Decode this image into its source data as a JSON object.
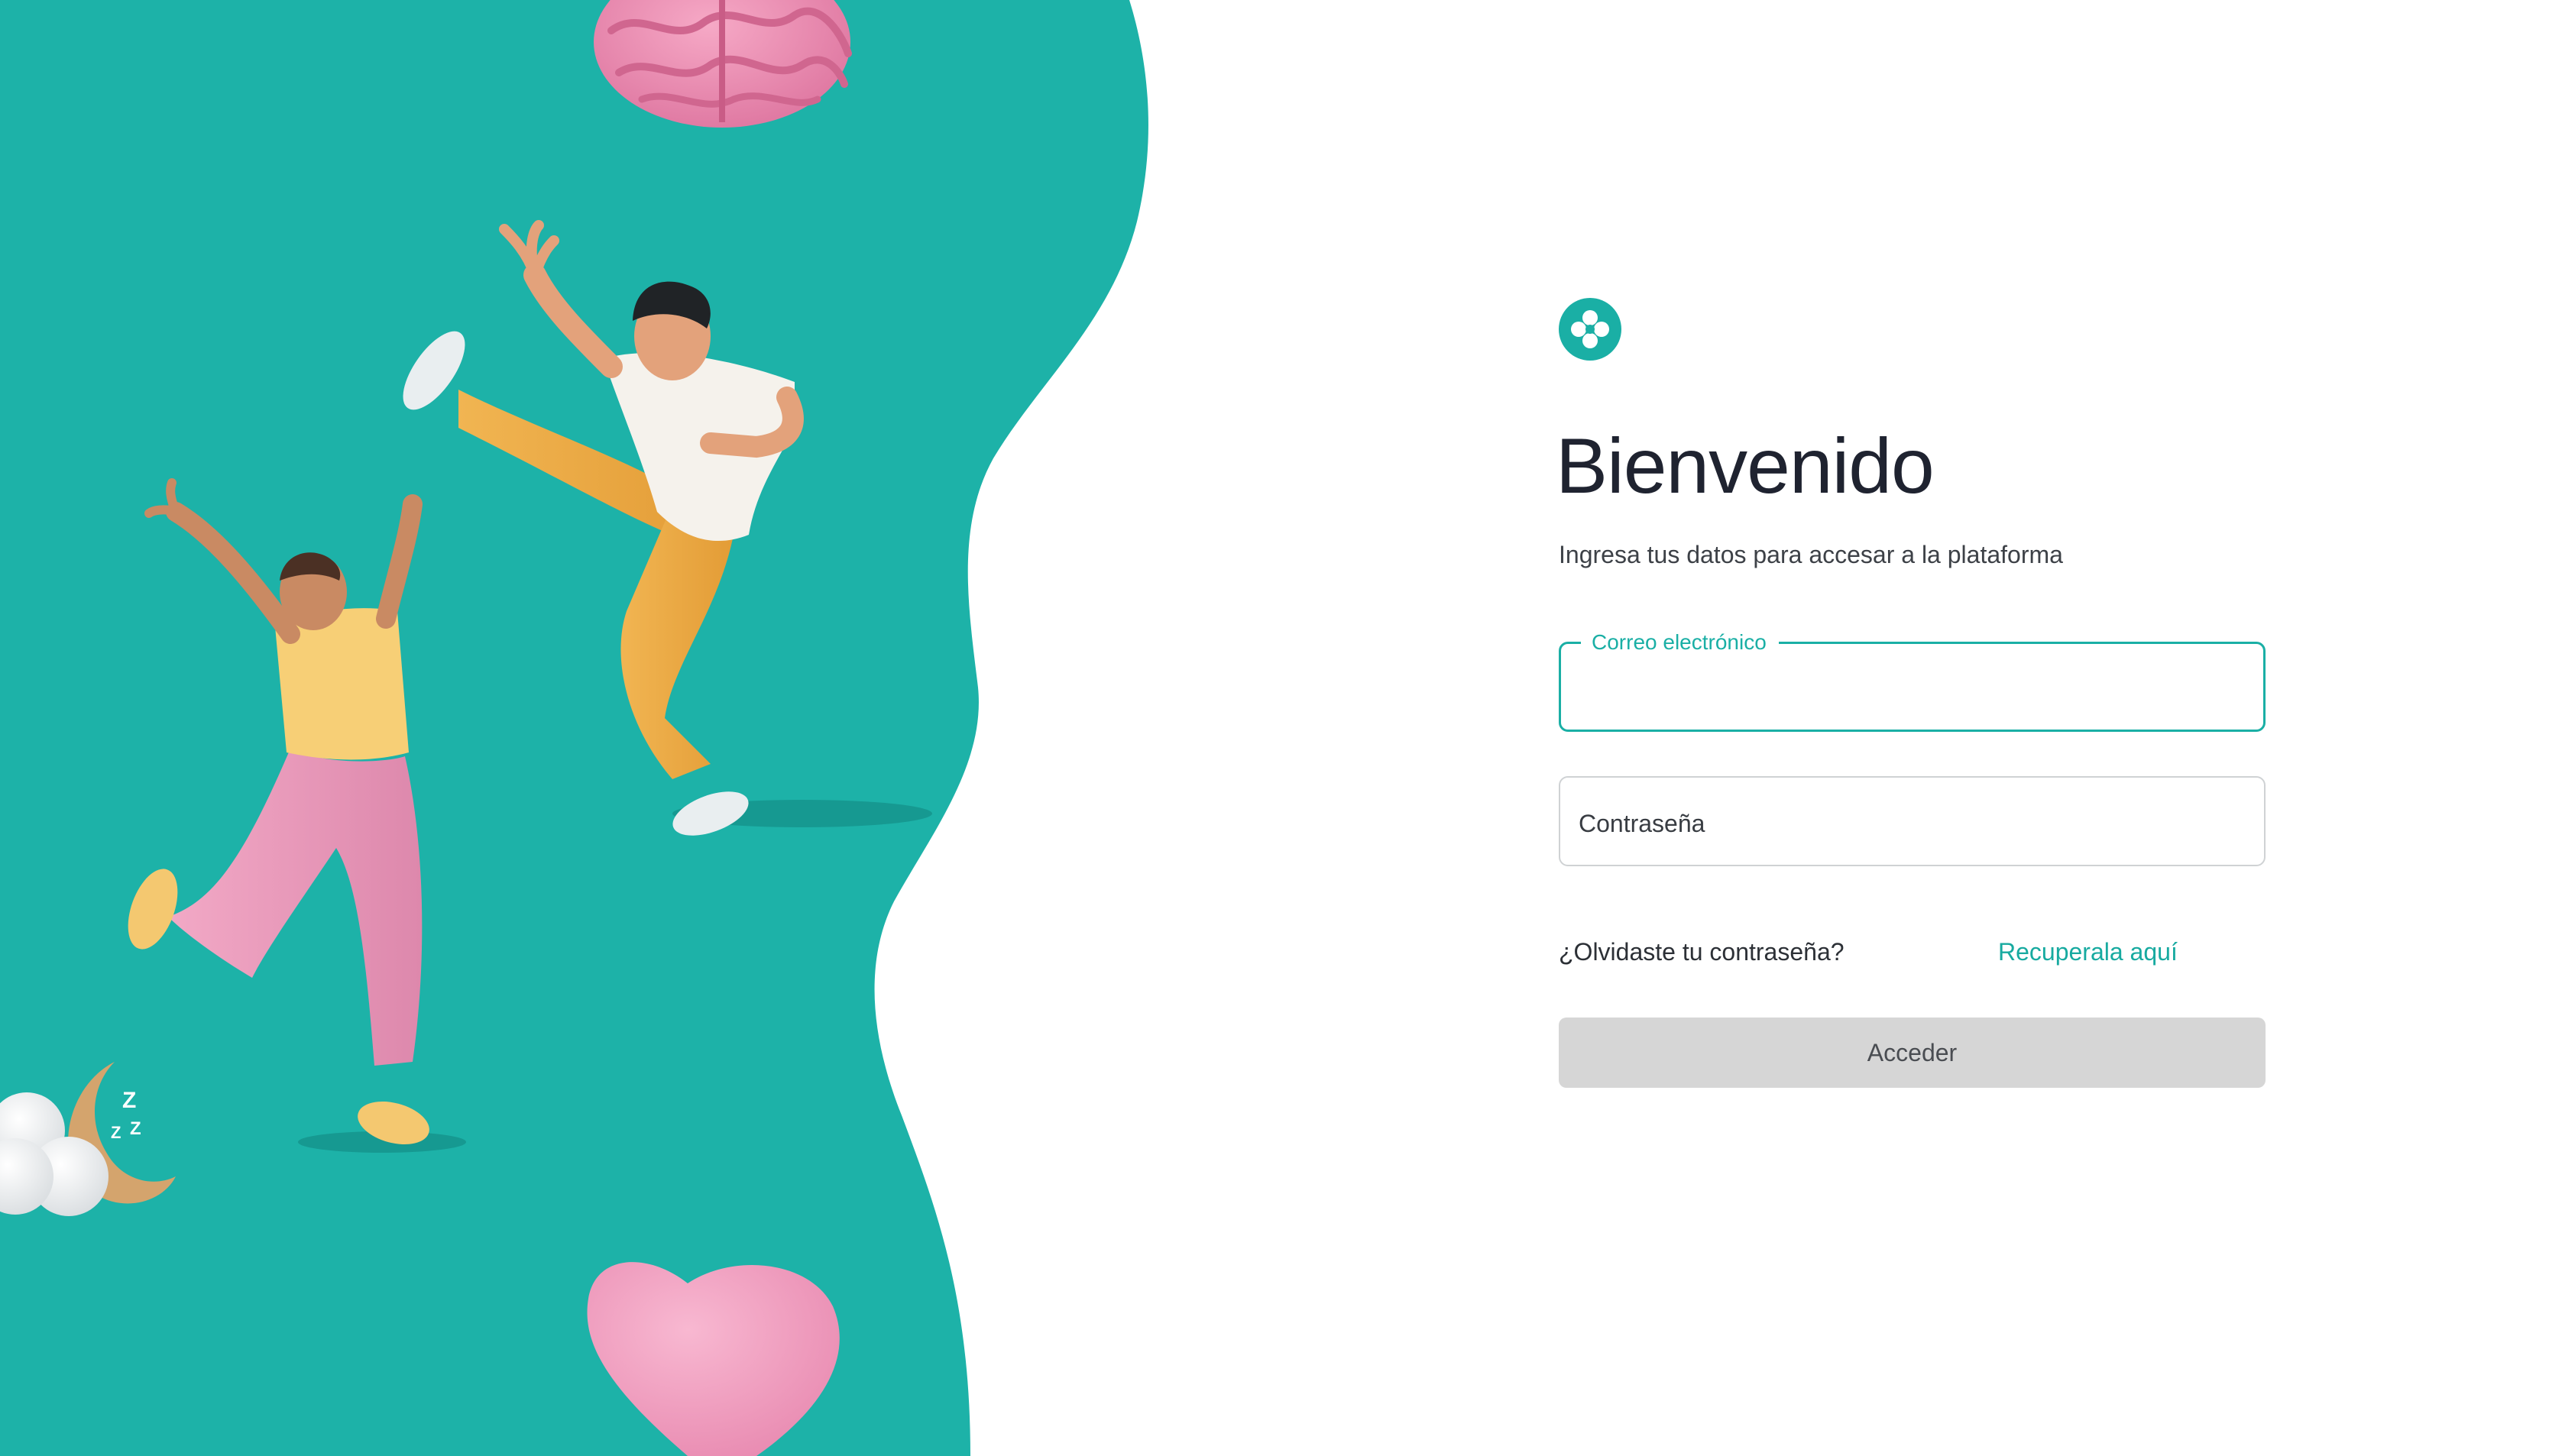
{
  "colors": {
    "accent": "#1aafa5",
    "panel_background": "#1db2a8",
    "button_disabled": "#d6d6d6"
  },
  "hero": {
    "illustrations": [
      "brain-icon",
      "jumping-man",
      "jumping-woman",
      "sleeping-moon-cloud-icon",
      "heart-icon"
    ]
  },
  "login": {
    "logo_icon": "clover-logo-icon",
    "title": "Bienvenido",
    "subtitle": "Ingresa tus datos para accesar a la plataforma",
    "email": {
      "label": "Correo electrónico",
      "value": ""
    },
    "password": {
      "placeholder": "Contraseña",
      "value": ""
    },
    "forgot_text": "¿Olvidaste tu contraseña?",
    "recover_link": "Recuperala aquí",
    "submit_label": "Acceder"
  }
}
